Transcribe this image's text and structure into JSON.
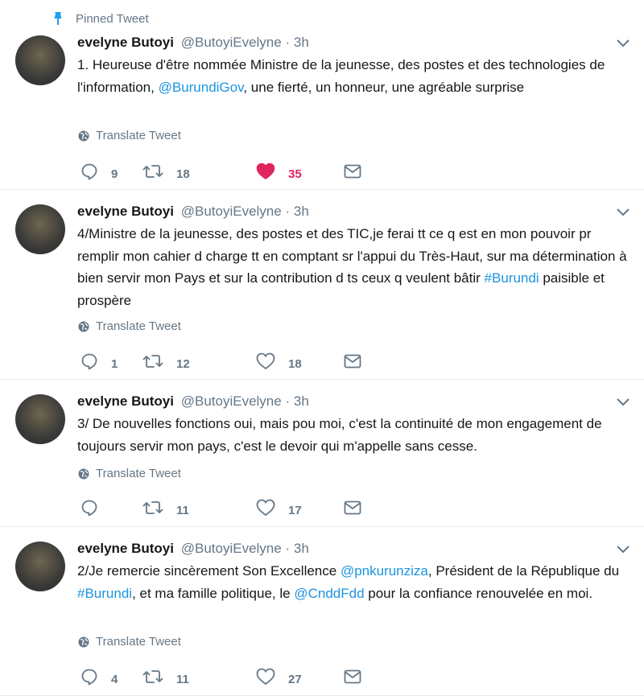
{
  "pinned_label": "Pinned Tweet",
  "translate_label": "Translate Tweet",
  "colors": {
    "link": "#1b95e0",
    "like": "#e0245e",
    "muted": "#657786"
  },
  "tweets": [
    {
      "name": "evelyne Butoyi",
      "handle": "@ButoyiEvelyne",
      "dot": "·",
      "time": "3h",
      "text": [
        {
          "t": "1. Heureuse d'être nommée Ministre de la jeunesse, des postes et des technologies de l'information, "
        },
        {
          "t": "@BurundiGov",
          "link": true
        },
        {
          "t": ", une fierté, un honneur, une agréable surprise"
        }
      ],
      "replies": "9",
      "retweets": "18",
      "likes": "35",
      "liked": true
    },
    {
      "name": "evelyne Butoyi",
      "handle": "@ButoyiEvelyne",
      "dot": "·",
      "time": "3h",
      "text": [
        {
          "t": "4/Ministre de la jeunesse,  des postes et des TIC,je ferai tt ce q est en mon pouvoir pr remplir mon cahier d charge tt en comptant sr l'appui du Très-Haut, sur ma détermination à bien servir mon Pays et sur la contribution d ts ceux q veulent bâtir "
        },
        {
          "t": "#Burundi",
          "link": true
        },
        {
          "t": " paisible et prospère"
        }
      ],
      "replies": "1",
      "retweets": "12",
      "likes": "18",
      "liked": false
    },
    {
      "name": "evelyne Butoyi",
      "handle": "@ButoyiEvelyne",
      "dot": "·",
      "time": "3h",
      "text": [
        {
          "t": "3/ De nouvelles fonctions oui, mais pou moi, c'est la continuité de mon engagement de toujours servir mon pays, c'est le devoir qui m'appelle sans cesse."
        }
      ],
      "replies": "",
      "retweets": "11",
      "likes": "17",
      "liked": false
    },
    {
      "name": "evelyne Butoyi",
      "handle": "@ButoyiEvelyne",
      "dot": "·",
      "time": "3h",
      "text": [
        {
          "t": "2/Je remercie sincèrement Son Excellence "
        },
        {
          "t": "@pnkurunziza",
          "link": true
        },
        {
          "t": ", Président de la République du "
        },
        {
          "t": "#Burundi",
          "link": true
        },
        {
          "t": ", et ma famille politique, le "
        },
        {
          "t": "@CnddFdd",
          "link": true
        },
        {
          "t": " pour la confiance renouvelée en moi."
        }
      ],
      "replies": "4",
      "retweets": "11",
      "likes": "27",
      "liked": false
    }
  ]
}
